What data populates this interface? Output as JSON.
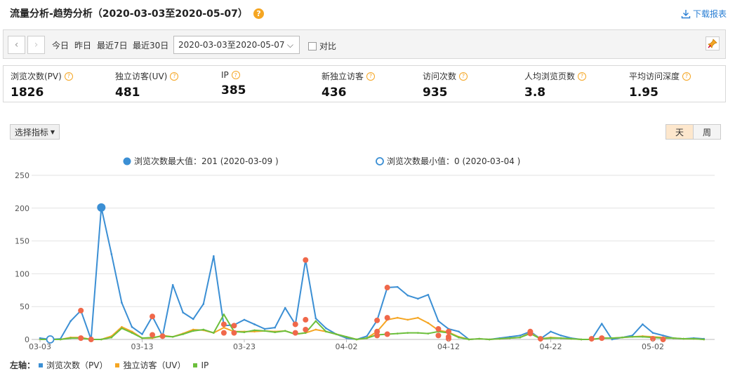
{
  "header": {
    "title": "流量分析-趋势分析（2020-03-03至2020-05-07）",
    "help_glyph": "?",
    "download_label": "下载报表"
  },
  "toolbar": {
    "quick_ranges": [
      "今日",
      "昨日",
      "最近7日",
      "最近30日"
    ],
    "date_range": "2020-03-03至2020-05-07",
    "compare_label": "对比"
  },
  "metrics": [
    {
      "label": "浏览次数(PV)",
      "value": "1826"
    },
    {
      "label": "独立访客(UV)",
      "value": "481"
    },
    {
      "label": "IP",
      "value": "385"
    },
    {
      "label": "新独立访客",
      "value": "436"
    },
    {
      "label": "访问次数",
      "value": "935"
    },
    {
      "label": "人均浏览页数",
      "value": "3.8"
    },
    {
      "label": "平均访问深度",
      "value": "1.95"
    }
  ],
  "controls": {
    "select_metric": "选择指标",
    "day": "天",
    "week": "周"
  },
  "chart_data": {
    "type": "line",
    "annotation_max": "浏览次数最大值：201 (2020-03-09 )",
    "annotation_min": "浏览次数最小值：0 (2020-03-04 )",
    "ylim": [
      0,
      250
    ],
    "yticks": [
      "0",
      "50",
      "100",
      "150",
      "200",
      "250"
    ],
    "xtick_labels": [
      "03-03",
      "03-13",
      "03-23",
      "04-02",
      "04-12",
      "04-22",
      "05-02"
    ],
    "xtick_index": [
      0,
      10,
      20,
      30,
      40,
      50,
      60
    ],
    "x_count": 66,
    "axis_prefix": "左轴：",
    "series": [
      {
        "name": "浏览次数（PV）",
        "color": "#3b8fd4",
        "values": [
          2,
          0,
          1,
          28,
          44,
          0,
          201,
          130,
          56,
          19,
          8,
          35,
          5,
          83,
          41,
          31,
          54,
          127,
          21,
          22,
          30,
          23,
          16,
          18,
          48,
          23,
          121,
          32,
          17,
          8,
          2,
          0,
          5,
          29,
          79,
          80,
          67,
          62,
          68,
          28,
          16,
          12,
          0,
          1,
          0,
          2,
          4,
          6,
          12,
          1,
          12,
          6,
          2,
          0,
          0,
          24,
          0,
          3,
          6,
          23,
          10,
          6,
          2,
          1,
          2,
          1,
          10,
          3
        ]
      },
      {
        "name": "独立访客（UV）",
        "color": "#f5a623",
        "values": [
          0,
          0,
          0,
          3,
          3,
          0,
          0,
          5,
          19,
          12,
          2,
          2,
          6,
          4,
          9,
          15,
          14,
          10,
          18,
          12,
          12,
          12,
          13,
          12,
          13,
          8,
          10,
          15,
          12,
          8,
          4,
          0,
          2,
          12,
          30,
          33,
          30,
          33,
          25,
          14,
          11,
          4,
          0,
          1,
          0,
          1,
          2,
          3,
          10,
          1,
          3,
          2,
          1,
          0,
          0,
          2,
          2,
          3,
          4,
          5,
          4,
          3,
          2,
          1,
          1,
          0,
          3,
          2
        ]
      },
      {
        "name": "IP",
        "color": "#6cbf3c",
        "values": [
          0,
          0,
          0,
          2,
          2,
          0,
          0,
          3,
          17,
          10,
          2,
          3,
          5,
          4,
          8,
          13,
          15,
          10,
          38,
          12,
          11,
          14,
          13,
          11,
          13,
          8,
          10,
          28,
          12,
          8,
          4,
          0,
          2,
          7,
          8,
          9,
          10,
          10,
          9,
          12,
          10,
          3,
          0,
          1,
          0,
          1,
          2,
          3,
          9,
          1,
          2,
          2,
          1,
          0,
          0,
          2,
          2,
          3,
          4,
          4,
          3,
          2,
          2,
          1,
          1,
          0,
          2,
          1
        ]
      }
    ],
    "red_markers": [
      {
        "x": 4,
        "y": 44
      },
      {
        "x": 5,
        "y": 0
      },
      {
        "x": 4,
        "y": 2
      },
      {
        "x": 11,
        "y": 35
      },
      {
        "x": 11,
        "y": 7
      },
      {
        "x": 12,
        "y": 5
      },
      {
        "x": 18,
        "y": 23
      },
      {
        "x": 19,
        "y": 21
      },
      {
        "x": 18,
        "y": 10
      },
      {
        "x": 19,
        "y": 10
      },
      {
        "x": 25,
        "y": 23
      },
      {
        "x": 25,
        "y": 10
      },
      {
        "x": 26,
        "y": 121
      },
      {
        "x": 26,
        "y": 30
      },
      {
        "x": 26,
        "y": 15
      },
      {
        "x": 33,
        "y": 29
      },
      {
        "x": 33,
        "y": 12
      },
      {
        "x": 33,
        "y": 6
      },
      {
        "x": 34,
        "y": 79
      },
      {
        "x": 34,
        "y": 33
      },
      {
        "x": 34,
        "y": 8
      },
      {
        "x": 39,
        "y": 16
      },
      {
        "x": 39,
        "y": 6
      },
      {
        "x": 40,
        "y": 12
      },
      {
        "x": 40,
        "y": 4
      },
      {
        "x": 40,
        "y": 1
      },
      {
        "x": 48,
        "y": 12
      },
      {
        "x": 48,
        "y": 9
      },
      {
        "x": 49,
        "y": 1
      },
      {
        "x": 54,
        "y": 1
      },
      {
        "x": 55,
        "y": 2
      },
      {
        "x": 60,
        "y": 1
      },
      {
        "x": 61,
        "y": 0
      }
    ],
    "max_point": {
      "x": 6,
      "y": 201
    },
    "min_point": {
      "x": 1,
      "y": 0
    }
  }
}
